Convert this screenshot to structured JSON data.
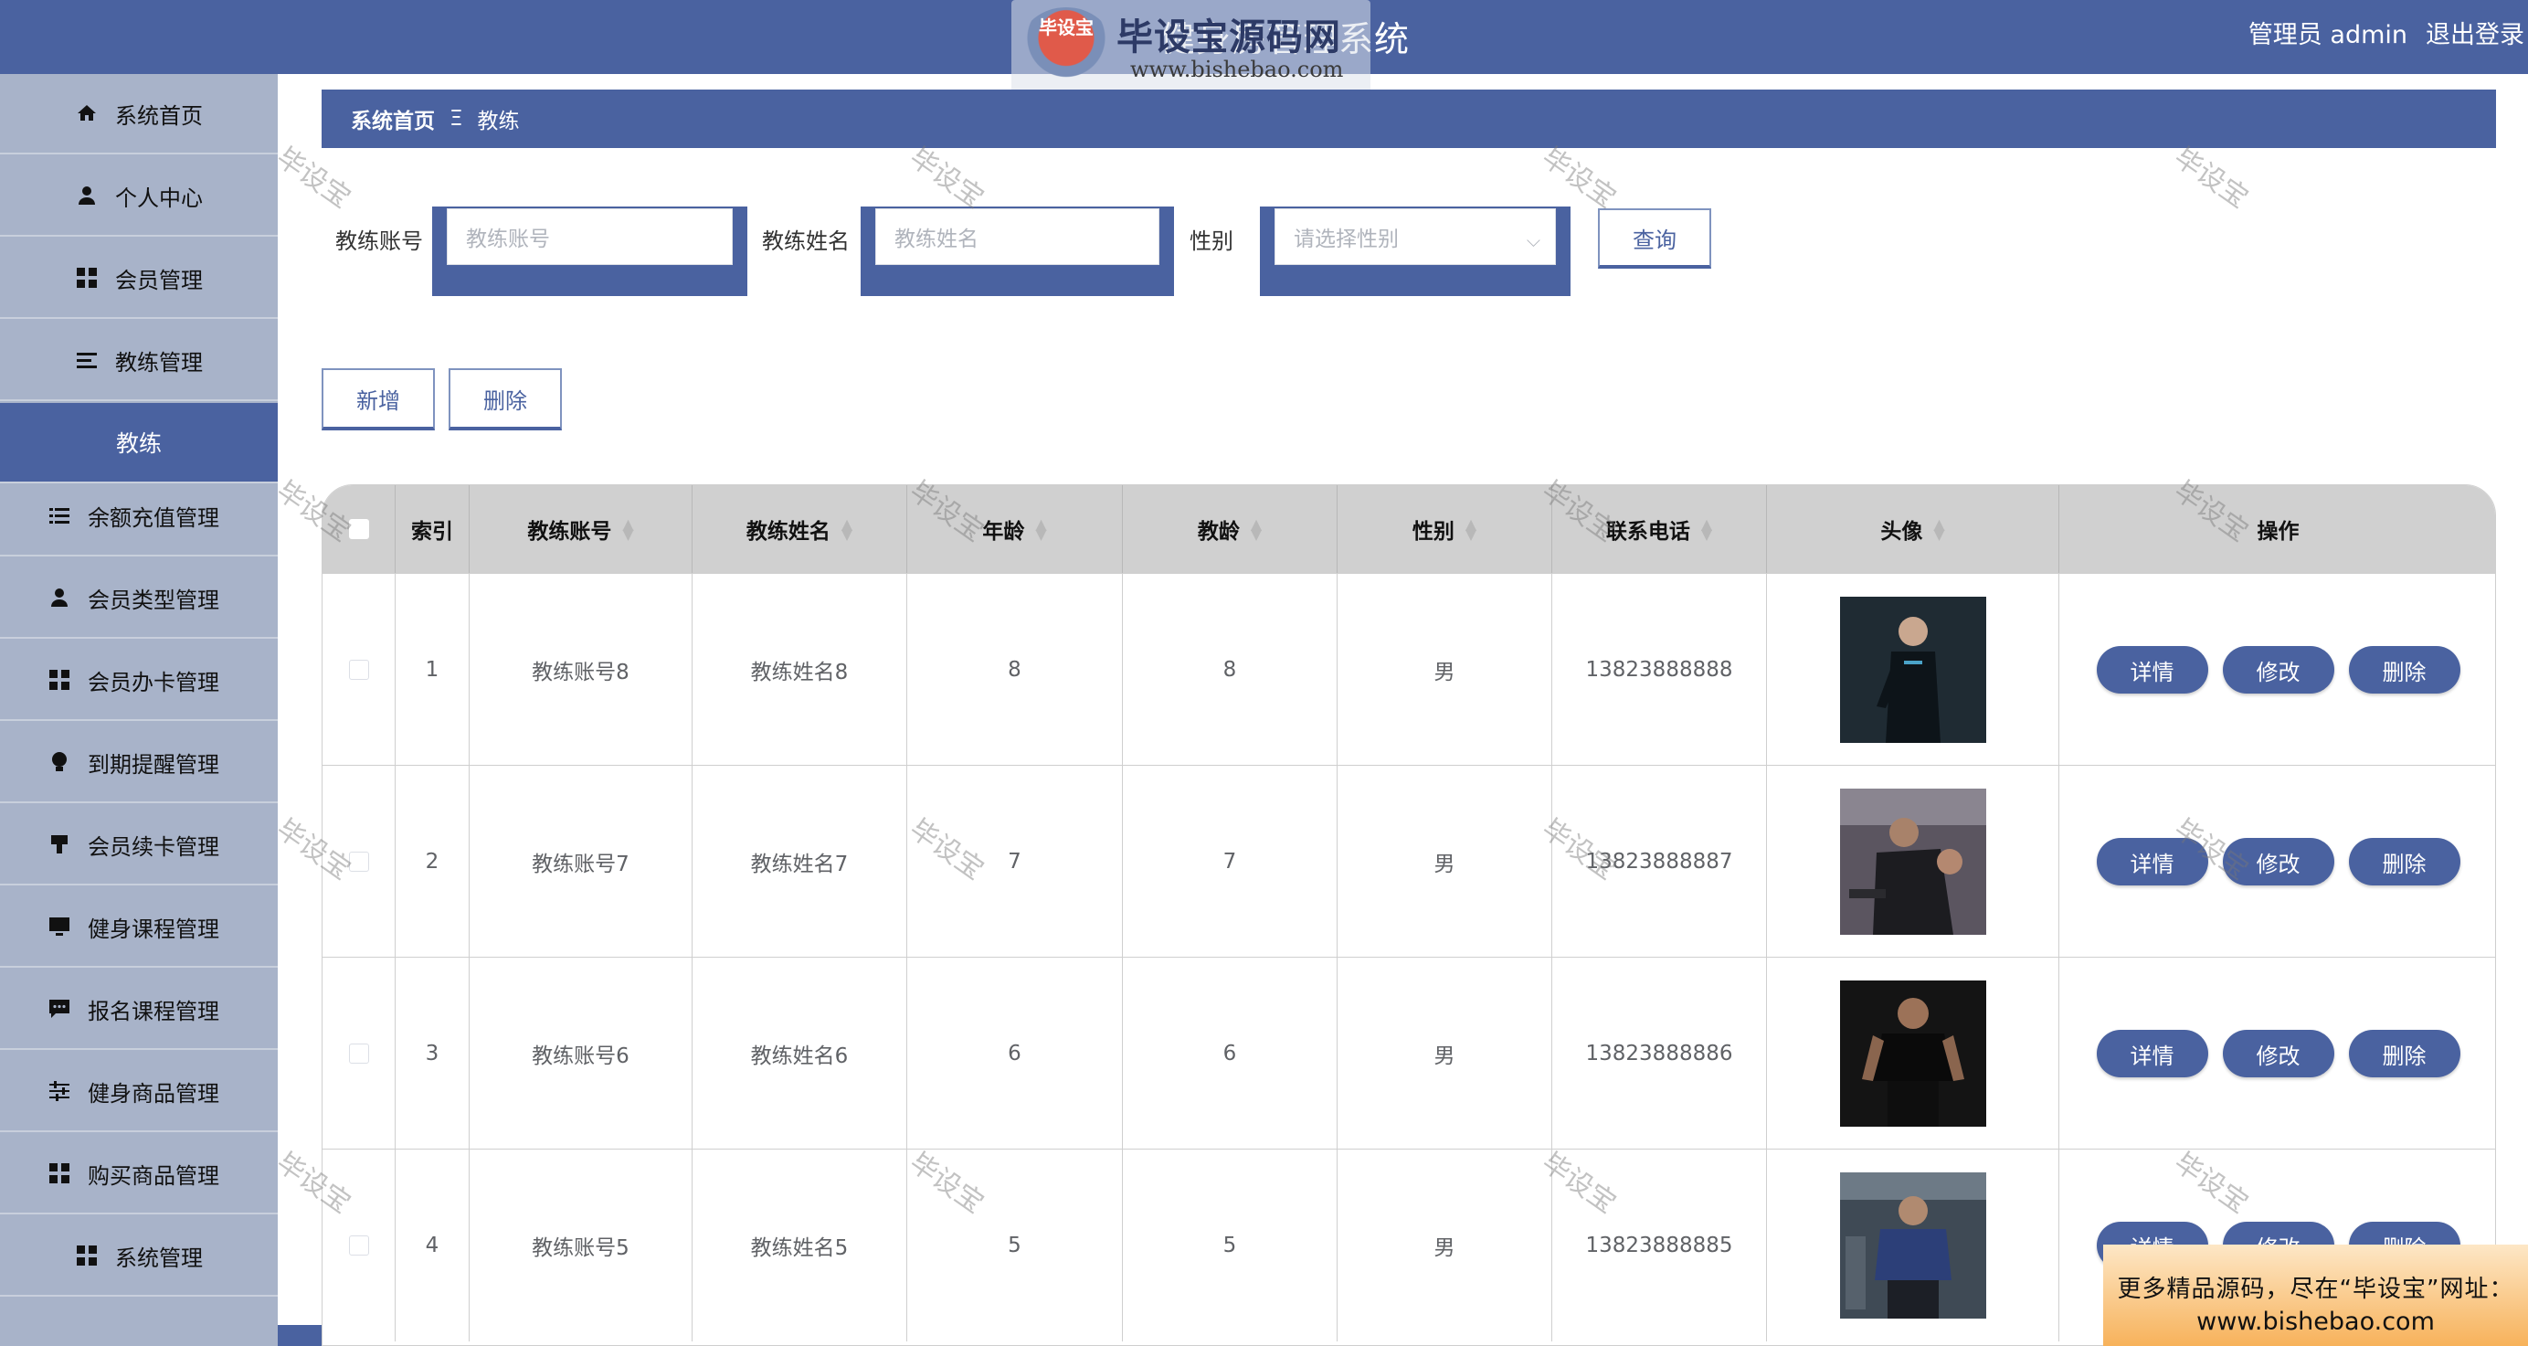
{
  "header": {
    "title": "健身房管理系统",
    "admin_label": "管理员 admin",
    "logout_label": "退出登录",
    "logo_badge": "毕设宝",
    "logo_text": "毕设宝源码网",
    "logo_url": "www.bishebao.com"
  },
  "sidebar": {
    "items": [
      {
        "label": "系统首页",
        "icon": "home-icon"
      },
      {
        "label": "个人中心",
        "icon": "user-icon"
      },
      {
        "label": "会员管理",
        "icon": "grid-icon"
      },
      {
        "label": "教练管理",
        "icon": "list-icon"
      },
      {
        "label": "教练",
        "icon": ""
      },
      {
        "label": "余额充值管理",
        "icon": "list-icon"
      },
      {
        "label": "会员类型管理",
        "icon": "user-icon"
      },
      {
        "label": "会员办卡管理",
        "icon": "grid-icon"
      },
      {
        "label": "到期提醒管理",
        "icon": "bulb-icon"
      },
      {
        "label": "会员续卡管理",
        "icon": "stamp-icon"
      },
      {
        "label": "健身课程管理",
        "icon": "monitor-icon"
      },
      {
        "label": "报名课程管理",
        "icon": "chat-icon"
      },
      {
        "label": "健身商品管理",
        "icon": "sliders-icon"
      },
      {
        "label": "购买商品管理",
        "icon": "grid-icon"
      },
      {
        "label": "系统管理",
        "icon": "grid-icon"
      }
    ]
  },
  "breadcrumb": {
    "home": "系统首页",
    "separator": "Ξ",
    "current": "教练"
  },
  "search": {
    "account_label": "教练账号",
    "account_placeholder": "教练账号",
    "name_label": "教练姓名",
    "name_placeholder": "教练姓名",
    "gender_label": "性别",
    "gender_placeholder": "请选择性别",
    "query_button": "查询"
  },
  "actions": {
    "add_button": "新增",
    "delete_button": "删除"
  },
  "table": {
    "columns": [
      "索引",
      "教练账号",
      "教练姓名",
      "年龄",
      "教龄",
      "性别",
      "联系电话",
      "头像",
      "操作"
    ],
    "row_buttons": {
      "detail": "详情",
      "edit": "修改",
      "delete": "删除"
    },
    "rows": [
      {
        "index": "1",
        "account": "教练账号8",
        "name": "教练姓名8",
        "age": "8",
        "years": "8",
        "gender": "男",
        "phone": "13823888888"
      },
      {
        "index": "2",
        "account": "教练账号7",
        "name": "教练姓名7",
        "age": "7",
        "years": "7",
        "gender": "男",
        "phone": "13823888887"
      },
      {
        "index": "3",
        "account": "教练账号6",
        "name": "教练姓名6",
        "age": "6",
        "years": "6",
        "gender": "男",
        "phone": "13823888886"
      },
      {
        "index": "4",
        "account": "教练账号5",
        "name": "教练姓名5",
        "age": "5",
        "years": "5",
        "gender": "男",
        "phone": "13823888885"
      }
    ]
  },
  "watermark": "毕设宝",
  "ad": {
    "line1": "更多精品源码，尽在“毕设宝”网址：",
    "line2": "www.bishebao.com"
  },
  "colors": {
    "primary": "#4a62a0",
    "sidebar": "#a8b3c9",
    "table_header": "#d0d0d0"
  }
}
